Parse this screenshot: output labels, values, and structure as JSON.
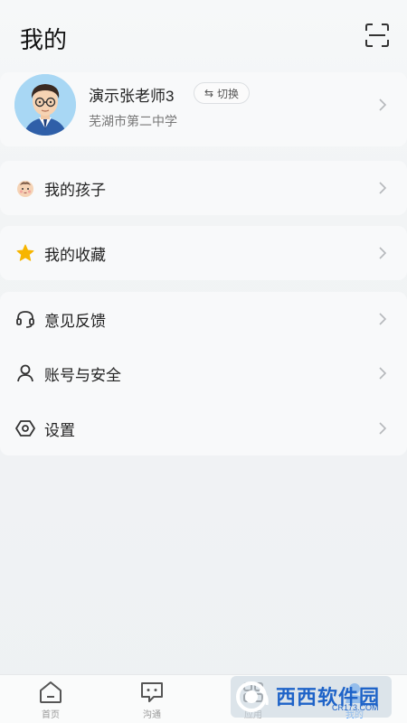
{
  "header": {
    "title": "我的",
    "scan_icon": "scan-icon"
  },
  "profile": {
    "name": "演示张老师3",
    "switch_label": "切换",
    "switch_icon": "swap-arrows-icon",
    "school": "芜湖市第二中学",
    "avatar_icon": "teacher-avatar"
  },
  "menu": {
    "children": {
      "label": "我的孩子",
      "icon": "baby-face-icon"
    },
    "favorites": {
      "label": "我的收藏",
      "icon": "star-icon"
    },
    "feedback": {
      "label": "意见反馈",
      "icon": "headset-icon"
    },
    "account": {
      "label": "账号与安全",
      "icon": "person-icon"
    },
    "settings": {
      "label": "设置",
      "icon": "hexagon-settings-icon"
    }
  },
  "bottom_nav": {
    "items": [
      {
        "label": "首页",
        "icon": "home-icon"
      },
      {
        "label": "沟通",
        "icon": "chat-icon"
      },
      {
        "label": "应用",
        "icon": "apps-icon"
      },
      {
        "label": "我的",
        "icon": "profile-icon"
      }
    ]
  },
  "watermark": {
    "text": "西西软件园",
    "sub": "CR173.COM"
  },
  "colors": {
    "background": "#eef1f3",
    "card": "#f8f9fa",
    "star": "#f7b500",
    "nav_active": "#2b8cff",
    "avatar_bg": "#a8d7f4"
  }
}
